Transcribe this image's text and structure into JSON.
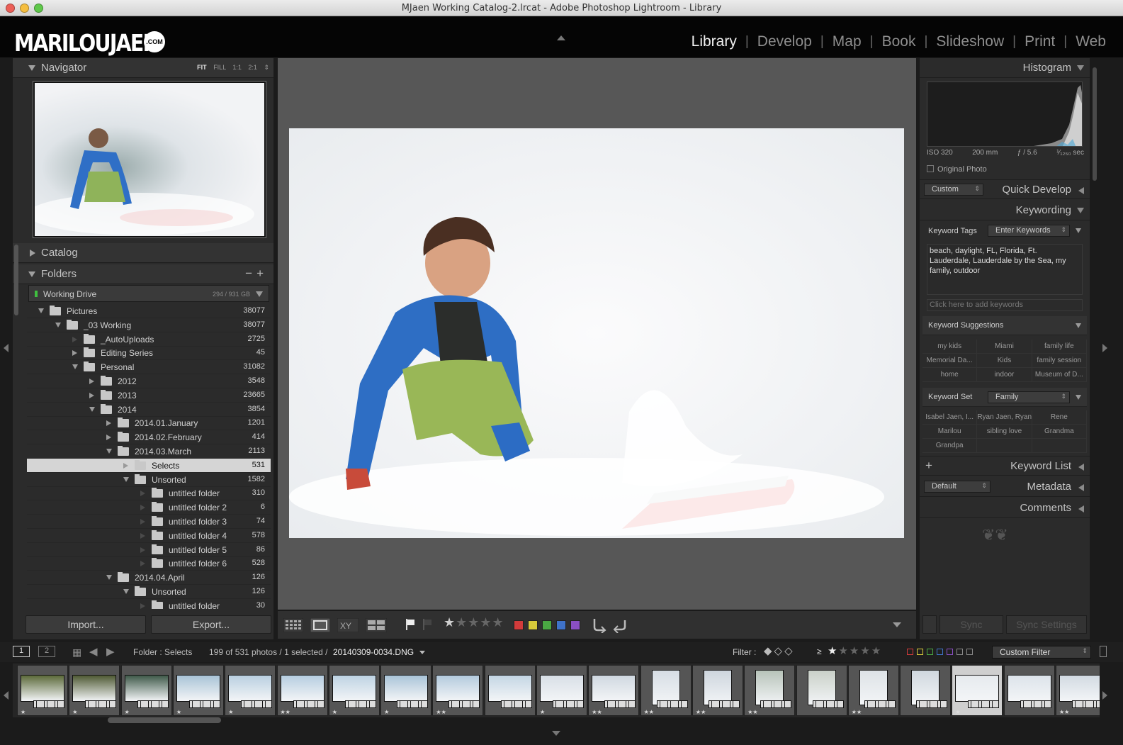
{
  "window": {
    "title": "MJaen Working Catalog-2.lrcat - Adobe Photoshop Lightroom - Library"
  },
  "identity": {
    "logo": "MARILOUJAEN",
    "logo_badge": ".COM"
  },
  "modules": [
    "Library",
    "Develop",
    "Map",
    "Book",
    "Slideshow",
    "Print",
    "Web"
  ],
  "active_module": "Library",
  "left_panel": {
    "navigator": {
      "title": "Navigator",
      "modes": [
        "FIT",
        "FILL",
        "1:1",
        "2:1"
      ]
    },
    "catalog": {
      "title": "Catalog"
    },
    "folders": {
      "title": "Folders",
      "volume": {
        "name": "Working Drive",
        "size": "294 / 931 GB"
      },
      "tree": [
        {
          "label": "Pictures",
          "count": "38077",
          "depth": 0,
          "state": "open"
        },
        {
          "label": "_03 Working",
          "count": "38077",
          "depth": 1,
          "state": "open"
        },
        {
          "label": "_AutoUploads",
          "count": "2725",
          "depth": 2,
          "state": "none"
        },
        {
          "label": "Editing Series",
          "count": "45",
          "depth": 2,
          "state": "closed"
        },
        {
          "label": "Personal",
          "count": "31082",
          "depth": 2,
          "state": "open"
        },
        {
          "label": "2012",
          "count": "3548",
          "depth": 3,
          "state": "closed"
        },
        {
          "label": "2013",
          "count": "23665",
          "depth": 3,
          "state": "closed"
        },
        {
          "label": "2014",
          "count": "3854",
          "depth": 3,
          "state": "open"
        },
        {
          "label": "2014.01.January",
          "count": "1201",
          "depth": 4,
          "state": "closed"
        },
        {
          "label": "2014.02.February",
          "count": "414",
          "depth": 4,
          "state": "closed"
        },
        {
          "label": "2014.03.March",
          "count": "2113",
          "depth": 4,
          "state": "open"
        },
        {
          "label": "Selects",
          "count": "531",
          "depth": 5,
          "state": "closed",
          "selected": true
        },
        {
          "label": "Unsorted",
          "count": "1582",
          "depth": 5,
          "state": "open"
        },
        {
          "label": "untitled folder",
          "count": "310",
          "depth": 6,
          "state": "none"
        },
        {
          "label": "untitled folder 2",
          "count": "6",
          "depth": 6,
          "state": "none"
        },
        {
          "label": "untitled folder 3",
          "count": "74",
          "depth": 6,
          "state": "none"
        },
        {
          "label": "untitled folder 4",
          "count": "578",
          "depth": 6,
          "state": "none"
        },
        {
          "label": "untitled folder 5",
          "count": "86",
          "depth": 6,
          "state": "none"
        },
        {
          "label": "untitled folder 6",
          "count": "528",
          "depth": 6,
          "state": "none"
        },
        {
          "label": "2014.04.April",
          "count": "126",
          "depth": 4,
          "state": "open"
        },
        {
          "label": "Unsorted",
          "count": "126",
          "depth": 5,
          "state": "open"
        },
        {
          "label": "untitled folder",
          "count": "30",
          "depth": 6,
          "state": "none"
        }
      ]
    },
    "import_label": "Import...",
    "export_label": "Export..."
  },
  "right_panel": {
    "histogram": {
      "title": "Histogram",
      "exif": {
        "iso": "ISO 320",
        "focal": "200 mm",
        "aperture": "ƒ / 5.6",
        "shutter": "¹⁄₁₂₅₀ sec"
      },
      "original_photo": "Original Photo"
    },
    "quick_develop": {
      "title": "Quick Develop",
      "preset": "Custom"
    },
    "keywording": {
      "title": "Keywording",
      "tags_label": "Keyword Tags",
      "tags_mode": "Enter Keywords",
      "keywords": "beach, daylight, FL, Florida, Ft. Lauderdale, Lauderdale by the Sea, my family, outdoor",
      "add_placeholder": "Click here to add keywords",
      "suggestions_label": "Keyword Suggestions",
      "suggestions": [
        "my kids",
        "Miami",
        "family life",
        "Memorial Da...",
        "Kids",
        "family session",
        "home",
        "indoor",
        "Museum of D..."
      ],
      "set_label": "Keyword Set",
      "set_value": "Family",
      "set_items": [
        "Isabel Jaen, I...",
        "Ryan Jaen, Ryan",
        "Rene",
        "Marilou",
        "sibling love",
        "Grandma",
        "Grandpa",
        "",
        ""
      ]
    },
    "keyword_list": {
      "title": "Keyword List"
    },
    "metadata": {
      "title": "Metadata",
      "preset": "Default"
    },
    "comments": {
      "title": "Comments"
    },
    "sync_label": "Sync",
    "sync_settings_label": "Sync Settings"
  },
  "filmstrip": {
    "screens": [
      "1",
      "2"
    ],
    "source": "Folder : Selects",
    "count_text": "199 of 531 photos / 1 selected /",
    "filename": "20140309-0034.DNG",
    "filter_label": "Filter :",
    "rating_op": "≥",
    "custom_filter": "Custom Filter",
    "thumbs": [
      {
        "stars": "★",
        "tone": "#5c6a3a",
        "portrait": false
      },
      {
        "stars": "★",
        "tone": "#4f5a34",
        "portrait": false
      },
      {
        "stars": "★",
        "tone": "#3f5a4a",
        "portrait": false
      },
      {
        "stars": "★",
        "tone": "#a9c3d6",
        "portrait": false
      },
      {
        "stars": "★",
        "tone": "#b9cfe0",
        "portrait": false
      },
      {
        "stars": "★★",
        "tone": "#b6cde0",
        "portrait": false
      },
      {
        "stars": "★",
        "tone": "#bed3e3",
        "portrait": false
      },
      {
        "stars": "★",
        "tone": "#aac4d8",
        "portrait": false
      },
      {
        "stars": "★★",
        "tone": "#b3cadd",
        "portrait": false
      },
      {
        "stars": "",
        "tone": "#c4d6e4",
        "portrait": false
      },
      {
        "stars": "★",
        "tone": "#d8dfe6",
        "portrait": false
      },
      {
        "stars": "★★",
        "tone": "#cfd8e0",
        "portrait": false
      },
      {
        "stars": "★★",
        "tone": "#d6dde4",
        "portrait": true
      },
      {
        "stars": "★★",
        "tone": "#cdd5dd",
        "portrait": true
      },
      {
        "stars": "★★",
        "tone": "#b7c3b9",
        "portrait": true
      },
      {
        "stars": "",
        "tone": "#c9d0c8",
        "portrait": true
      },
      {
        "stars": "★★",
        "tone": "#dde2e6",
        "portrait": true
      },
      {
        "stars": "",
        "tone": "#cfd7de",
        "portrait": true
      },
      {
        "stars": "★",
        "tone": "#e6eaee",
        "portrait": false,
        "selected": true
      },
      {
        "stars": "",
        "tone": "#dce3ea",
        "portrait": false
      },
      {
        "stars": "★★",
        "tone": "#d2dae2",
        "portrait": false
      }
    ]
  },
  "colors": {
    "label_red": "#d23b3b",
    "label_yellow": "#d6c93a",
    "label_green": "#4aa743",
    "label_blue": "#3f73c9",
    "label_purple": "#8a4fc4"
  }
}
